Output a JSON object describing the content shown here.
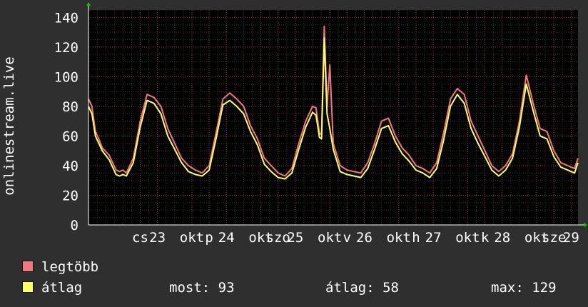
{
  "chart_data": {
    "type": "line",
    "ylabel": "onlinestream.live",
    "ylim": [
      0,
      145
    ],
    "yticks": [
      0,
      20,
      40,
      60,
      80,
      100,
      120,
      140
    ],
    "xticks": [
      {
        "x": 0.75,
        "label": "cs"
      },
      {
        "x": 1.0,
        "label": "23"
      },
      {
        "x": 1.5,
        "label": "okt"
      },
      {
        "x": 1.75,
        "label": "p"
      },
      {
        "x": 2.0,
        "label": "24"
      },
      {
        "x": 2.5,
        "label": "okt"
      },
      {
        "x": 2.75,
        "label": "szo"
      },
      {
        "x": 3.0,
        "label": "25"
      },
      {
        "x": 3.5,
        "label": "okt"
      },
      {
        "x": 3.75,
        "label": "v"
      },
      {
        "x": 4.0,
        "label": "26"
      },
      {
        "x": 4.5,
        "label": "okt"
      },
      {
        "x": 4.75,
        "label": "h"
      },
      {
        "x": 5.0,
        "label": "27"
      },
      {
        "x": 5.5,
        "label": "okt"
      },
      {
        "x": 5.75,
        "label": "k"
      },
      {
        "x": 6.0,
        "label": "28"
      },
      {
        "x": 6.5,
        "label": "okt"
      },
      {
        "x": 6.75,
        "label": "sze"
      },
      {
        "x": 7.0,
        "label": "29"
      }
    ],
    "xlim": [
      0.0,
      7.1
    ],
    "grid": true,
    "colors": {
      "background": "#2f2f2f",
      "plot": "#000000",
      "grid_minor": "#4a2a2a",
      "grid_major": "#8a3c3c",
      "axis": "#ffffff"
    },
    "series": [
      {
        "name": "legtöbb",
        "color": "#f07882",
        "x": [
          0.0,
          0.05,
          0.1,
          0.15,
          0.2,
          0.3,
          0.4,
          0.45,
          0.5,
          0.55,
          0.65,
          0.75,
          0.85,
          0.95,
          1.05,
          1.15,
          1.25,
          1.35,
          1.45,
          1.55,
          1.65,
          1.75,
          1.85,
          1.95,
          2.05,
          2.15,
          2.25,
          2.35,
          2.45,
          2.55,
          2.65,
          2.75,
          2.85,
          2.95,
          3.05,
          3.15,
          3.25,
          3.3,
          3.35,
          3.38,
          3.42,
          3.46,
          3.5,
          3.55,
          3.65,
          3.75,
          3.85,
          3.95,
          4.05,
          4.15,
          4.25,
          4.35,
          4.45,
          4.55,
          4.65,
          4.75,
          4.85,
          4.95,
          5.05,
          5.15,
          5.25,
          5.35,
          5.45,
          5.55,
          5.65,
          5.75,
          5.85,
          5.95,
          6.05,
          6.15,
          6.25,
          6.35,
          6.45,
          6.55,
          6.65,
          6.75,
          6.85,
          6.95,
          7.05,
          7.1
        ],
        "values": [
          85,
          80,
          63,
          58,
          52,
          47,
          37,
          36,
          37,
          35,
          45,
          70,
          88,
          86,
          80,
          65,
          55,
          45,
          40,
          37,
          35,
          40,
          62,
          85,
          89,
          85,
          80,
          67,
          58,
          45,
          40,
          35,
          33,
          38,
          55,
          70,
          80,
          79,
          62,
          61,
          134,
          80,
          108,
          55,
          40,
          37,
          36,
          35,
          42,
          55,
          70,
          72,
          60,
          52,
          47,
          40,
          38,
          35,
          42,
          62,
          85,
          92,
          88,
          70,
          60,
          50,
          40,
          36,
          40,
          48,
          70,
          101,
          82,
          65,
          63,
          50,
          42,
          40,
          38,
          45
        ],
        "note": "",
        "x_end": 7.1
      },
      {
        "name": "átlag",
        "color": "#ffff66",
        "x": [
          0.0,
          0.05,
          0.1,
          0.15,
          0.2,
          0.3,
          0.4,
          0.45,
          0.5,
          0.55,
          0.65,
          0.75,
          0.85,
          0.95,
          1.05,
          1.15,
          1.25,
          1.35,
          1.45,
          1.55,
          1.65,
          1.75,
          1.85,
          1.95,
          2.05,
          2.15,
          2.25,
          2.35,
          2.45,
          2.55,
          2.65,
          2.75,
          2.85,
          2.95,
          3.05,
          3.15,
          3.25,
          3.3,
          3.35,
          3.38,
          3.42,
          3.46,
          3.5,
          3.55,
          3.65,
          3.75,
          3.85,
          3.95,
          4.05,
          4.15,
          4.25,
          4.35,
          4.45,
          4.55,
          4.65,
          4.75,
          4.85,
          4.95,
          5.05,
          5.15,
          5.25,
          5.35,
          5.45,
          5.55,
          5.65,
          5.75,
          5.85,
          5.95,
          6.05,
          6.15,
          6.25,
          6.35,
          6.45,
          6.55,
          6.65,
          6.75,
          6.85,
          6.95,
          7.05,
          7.1
        ],
        "values": [
          80,
          75,
          60,
          55,
          50,
          44,
          34,
          33,
          34,
          33,
          42,
          66,
          84,
          82,
          75,
          60,
          51,
          42,
          36,
          34,
          33,
          37,
          58,
          81,
          84,
          80,
          75,
          63,
          54,
          41,
          36,
          32,
          31,
          35,
          51,
          66,
          76,
          74,
          59,
          58,
          126,
          75,
          65,
          51,
          36,
          34,
          33,
          32,
          38,
          51,
          65,
          67,
          56,
          48,
          43,
          37,
          35,
          32,
          38,
          57,
          80,
          88,
          82,
          65,
          55,
          46,
          37,
          33,
          37,
          45,
          66,
          95,
          77,
          60,
          58,
          46,
          39,
          37,
          35,
          42
        ],
        "note": "",
        "x_end": 7.1
      }
    ]
  },
  "legend": [
    {
      "label": "legtöbb",
      "color": "#f07882"
    },
    {
      "label": "átlag",
      "color": "#ffff66"
    }
  ],
  "stats": {
    "most": "most: 93",
    "atlag": "átlag: 58",
    "max": "max: 129"
  }
}
